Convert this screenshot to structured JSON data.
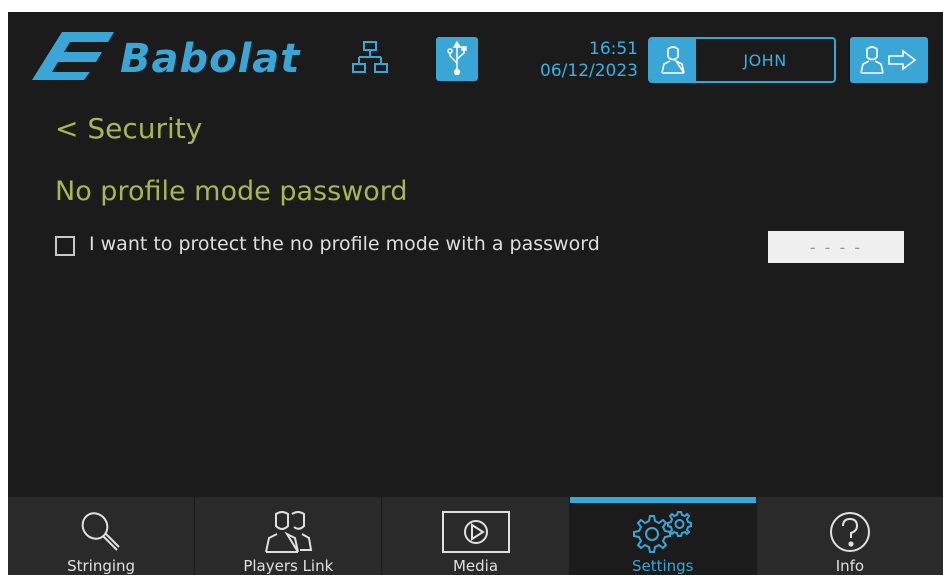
{
  "header": {
    "brand": "Babolat",
    "time": "16:51",
    "date": "06/12/2023",
    "user_name": "JOHN"
  },
  "page": {
    "back_label": "< Security",
    "section_title": "No profile mode password",
    "checkbox_label": "I want to protect the no profile mode with a password",
    "checkbox_checked": false,
    "password_placeholder": "- - - -"
  },
  "nav": {
    "items": [
      {
        "label": "Stringing",
        "icon": "racket-icon"
      },
      {
        "label": "Players Link",
        "icon": "players-icon"
      },
      {
        "label": "Media",
        "icon": "play-icon"
      },
      {
        "label": "Settings",
        "icon": "gears-icon",
        "active": true
      },
      {
        "label": "Info",
        "icon": "help-icon"
      }
    ]
  },
  "colors": {
    "accent": "#3aa6d6",
    "title": "#a6b753",
    "background": "#1b1b1b"
  }
}
